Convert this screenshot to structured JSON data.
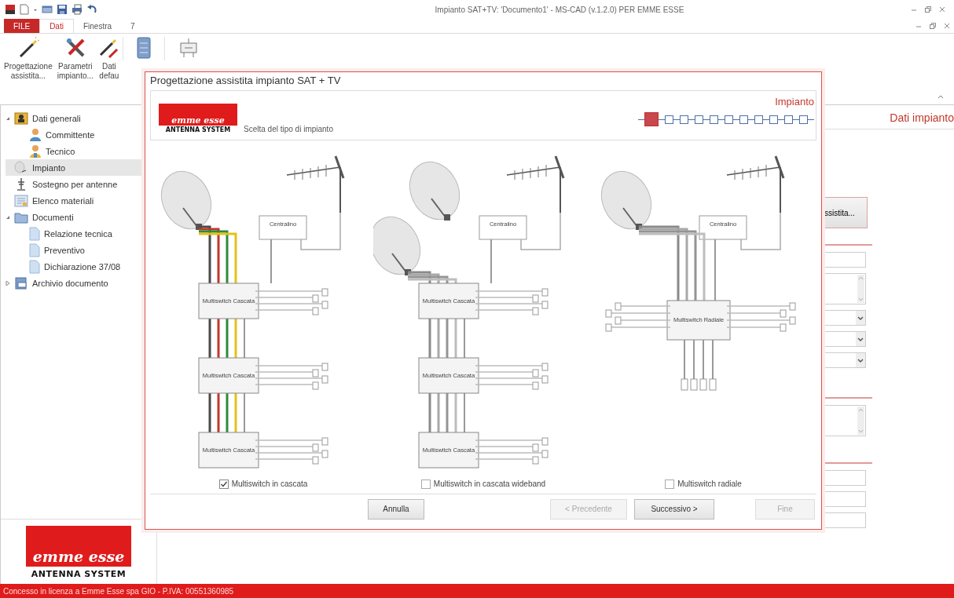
{
  "window": {
    "title": "Impianto SAT+TV: 'Documento1' - MS-CAD (v.1.2.0) PER EMME ESSE"
  },
  "ribbon_tabs": [
    {
      "label": "FILE",
      "kind": "file",
      "selected": false
    },
    {
      "label": "Dati",
      "kind": "tab",
      "selected": true
    },
    {
      "label": "Finestra",
      "kind": "tab",
      "selected": false
    },
    {
      "label": "7",
      "kind": "tab",
      "selected": false
    }
  ],
  "ribbon_buttons": [
    {
      "lines": [
        "Progettazione",
        "assistita..."
      ],
      "kind": "wand"
    },
    {
      "lines": [
        "Parametri",
        "impianto..."
      ],
      "kind": "tools"
    },
    {
      "lines": [
        "Dati",
        "defau"
      ],
      "kind": "wand-edit"
    },
    {
      "kind": "server"
    },
    {
      "kind": "splitter"
    }
  ],
  "sidebar": {
    "items": [
      {
        "label": "Dati generali",
        "kind": "group",
        "selected": false,
        "expanded": true,
        "children": [
          {
            "label": "Committente",
            "kind": "person",
            "selected": false
          },
          {
            "label": "Tecnico",
            "kind": "technician",
            "selected": false
          }
        ]
      },
      {
        "label": "Impianto",
        "kind": "dish",
        "selected": true
      },
      {
        "label": "Sostegno per antenne",
        "kind": "mast",
        "selected": false
      },
      {
        "label": "Elenco materiali",
        "kind": "list",
        "selected": false
      },
      {
        "label": "Documenti",
        "kind": "folder",
        "selected": false,
        "expanded": true,
        "children": [
          {
            "label": "Relazione tecnica",
            "kind": "document",
            "selected": false
          },
          {
            "label": "Preventivo",
            "kind": "document",
            "selected": false
          },
          {
            "label": "Dichiarazione 37/08",
            "kind": "document",
            "selected": false
          }
        ]
      },
      {
        "label": "Archivio documento",
        "kind": "archive",
        "selected": false,
        "expanded": false
      }
    ],
    "logo": {
      "brand": "emme esse",
      "tagline": "ANTENNA SYSTEM"
    }
  },
  "panel": {
    "title": "Dati impianto",
    "button": "ssistita..."
  },
  "dialog": {
    "title": "Progettazione assistita impianto SAT + TV",
    "logo": {
      "brand": "emme esse",
      "tagline": "ANTENNA SYSTEM"
    },
    "subtitle": "Scelta del tipo di impianto",
    "section": "Impianto",
    "steps": [
      {
        "selected": true
      },
      {
        "selected": false
      },
      {
        "selected": false
      },
      {
        "selected": false
      },
      {
        "selected": false
      },
      {
        "selected": false
      },
      {
        "selected": false
      },
      {
        "selected": false
      },
      {
        "selected": false
      },
      {
        "selected": false
      },
      {
        "selected": false
      }
    ],
    "options": [
      {
        "label": "Multiswitch in cascata",
        "kind": "cascade",
        "checked": true,
        "centralino": "Centralino",
        "multiswitch": [
          "Multiswitch Cascata",
          "Multiswitch Cascata",
          "Multiswitch Cascata"
        ]
      },
      {
        "label": "Multiswitch in cascata wideband",
        "kind": "cascade_wideband",
        "checked": false,
        "centralino": "Centralino",
        "multiswitch": [
          "Multiswitch Cascata",
          "Multiswitch Cascata",
          "Multiswitch Cascata"
        ]
      },
      {
        "label": "Multiswitch radiale",
        "kind": "radial",
        "checked": false,
        "centralino": "Centralino",
        "multiswitch": [
          "Multiswitch Radiale"
        ]
      }
    ],
    "buttons": [
      {
        "label": "Annulla",
        "disabled": false
      },
      {
        "label": "< Precedente",
        "disabled": true
      },
      {
        "label": "Successivo >",
        "disabled": false
      },
      {
        "label": "Fine",
        "disabled": true
      }
    ]
  },
  "status_bar": {
    "text": "Concesso in licenza a Emme Esse spa GIO - P.IVA: 00551360985"
  }
}
